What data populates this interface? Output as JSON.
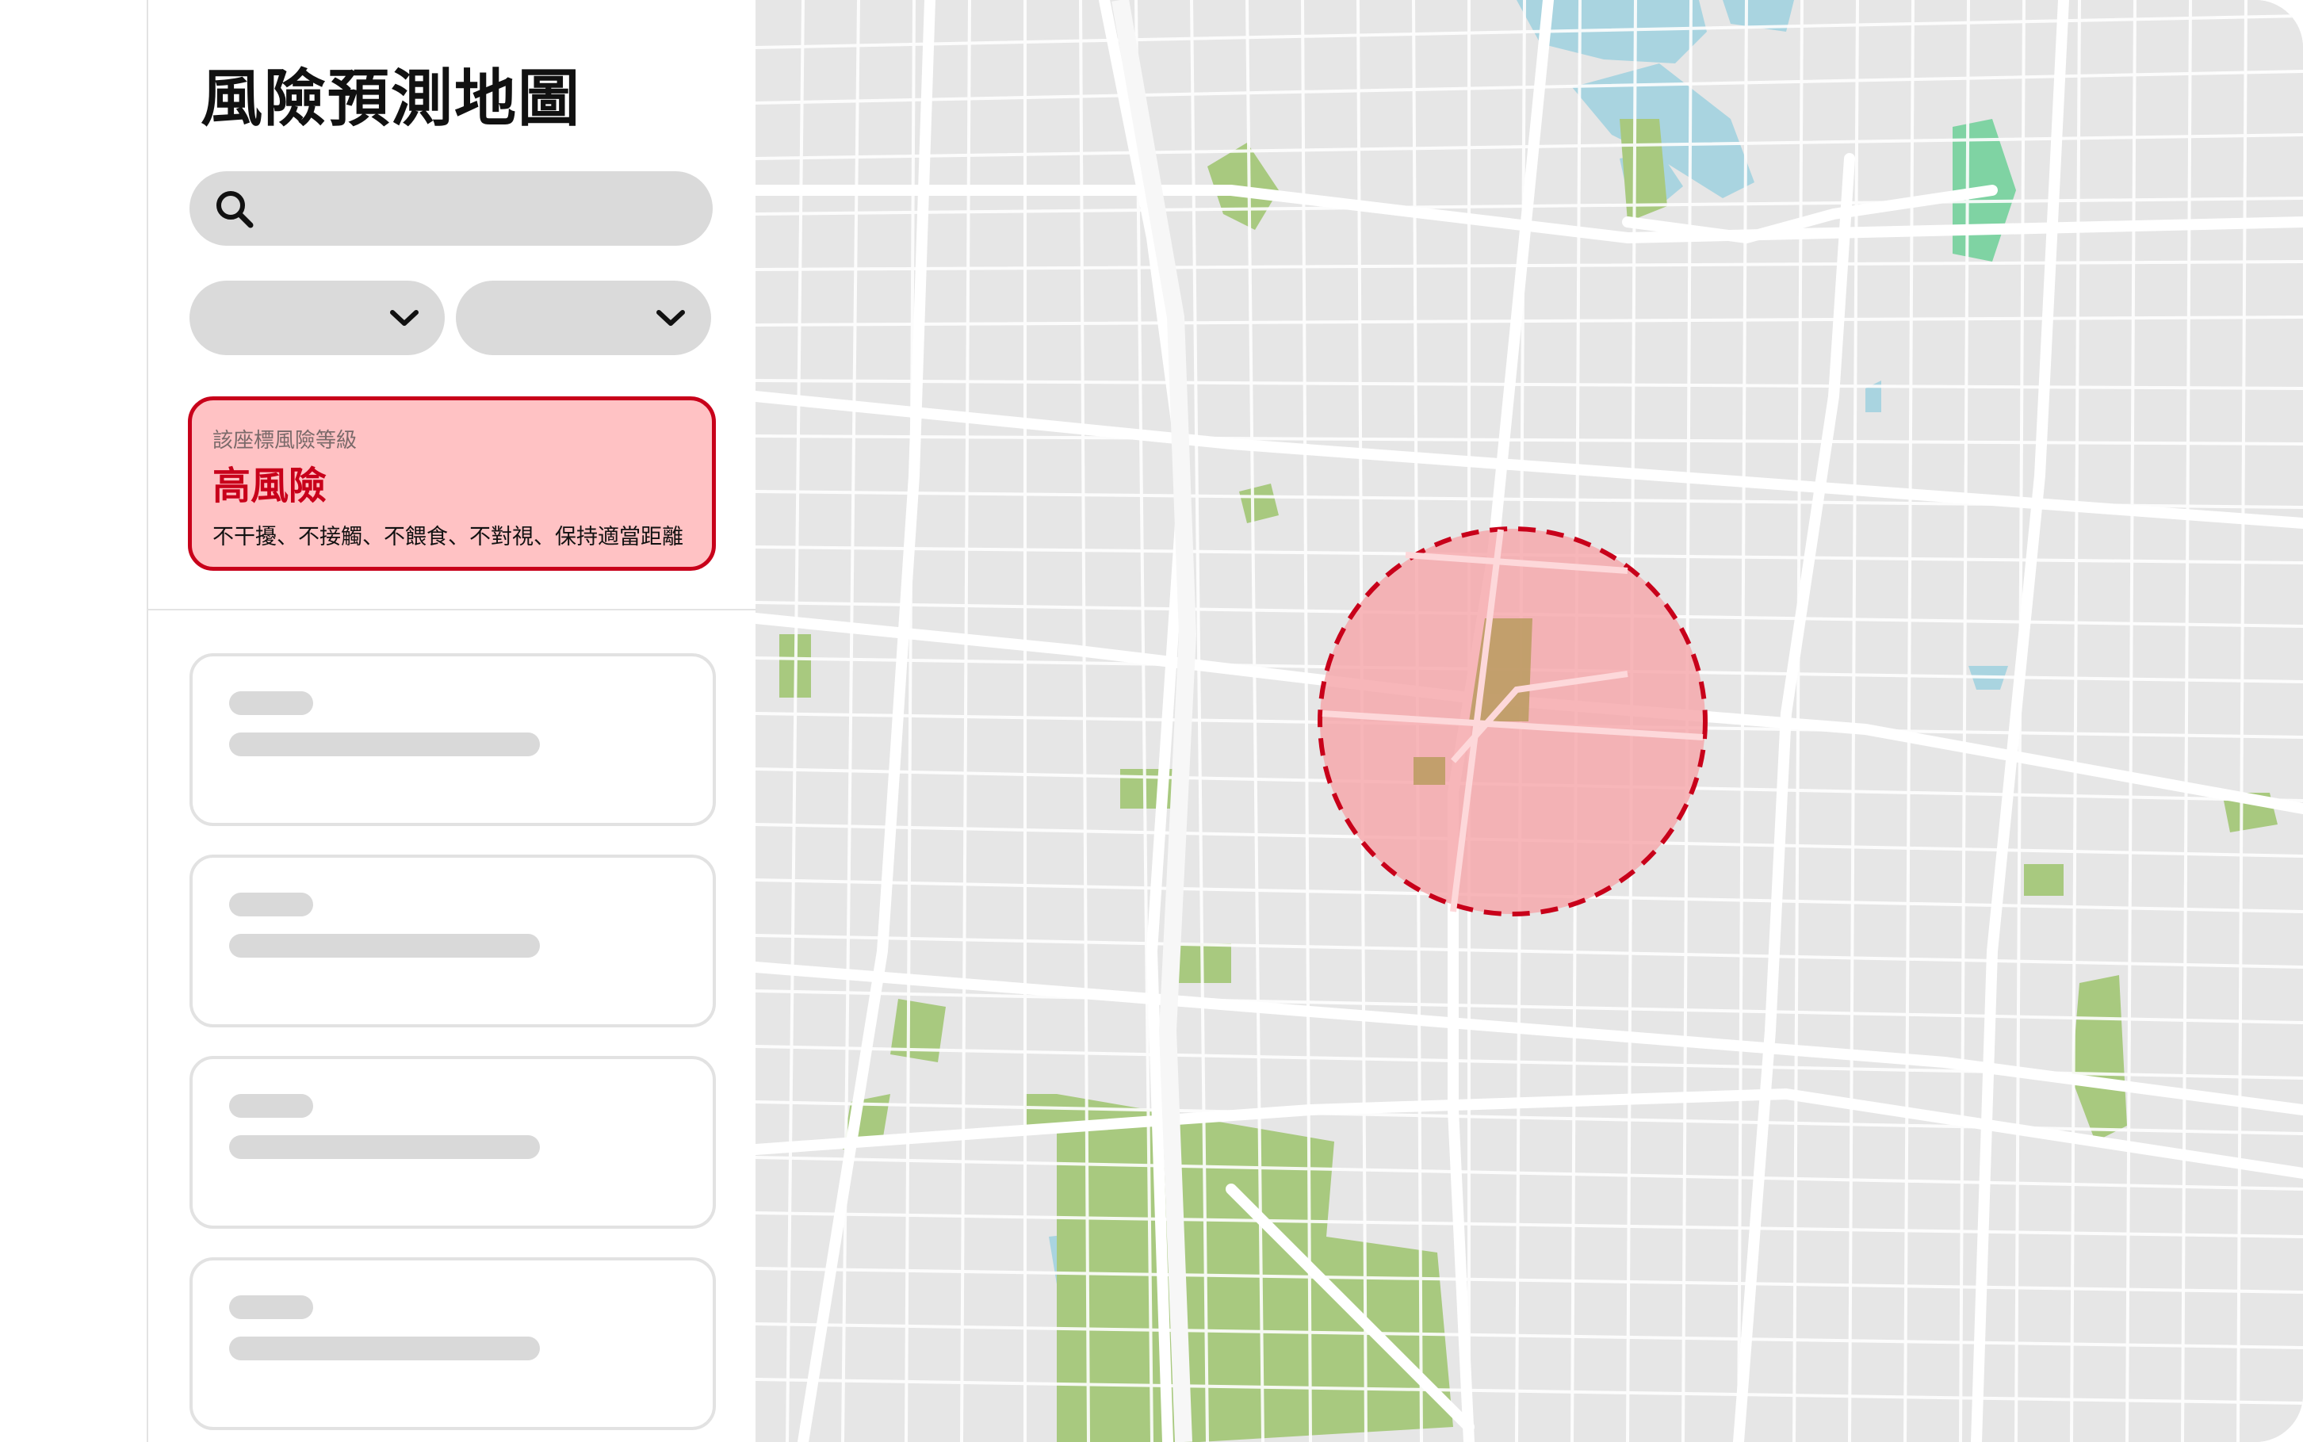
{
  "app": {
    "title": "風險預測地圖"
  },
  "search": {
    "placeholder": "",
    "value": "",
    "icon": "search-icon"
  },
  "filters": [
    {
      "value": "",
      "icon": "chevron-down-icon"
    },
    {
      "value": "",
      "icon": "chevron-down-icon"
    }
  ],
  "risk": {
    "label": "該座標風險等級",
    "level": "高風險",
    "advice": "不干擾、不接觸、不餵食、不對視、保持適當距離",
    "accent_color": "#c8001a",
    "fill_color": "#ffc2c4"
  },
  "results": {
    "items": [
      {
        "state": "loading"
      },
      {
        "state": "loading"
      },
      {
        "state": "loading"
      },
      {
        "state": "loading"
      }
    ]
  },
  "map": {
    "base_color": "#e6e6e6",
    "road_color": "#ffffff",
    "park_color": "#a8c97f",
    "water_color": "#a9d4e0",
    "risk_zone": {
      "level": "high",
      "fill_color": "#f5a6aa",
      "stroke_color": "#c8001a",
      "stroke_style": "dashed"
    }
  }
}
